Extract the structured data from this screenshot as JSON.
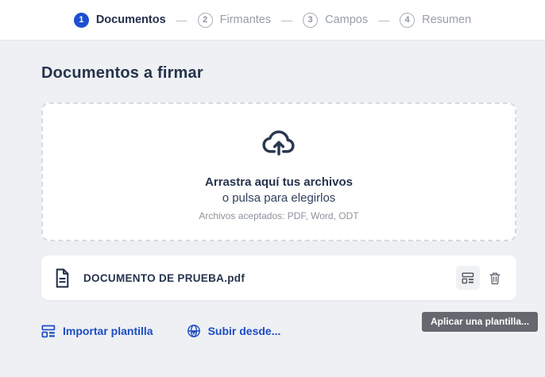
{
  "stepper": {
    "separator": "—",
    "steps": [
      {
        "number": "1",
        "label": "Documentos",
        "state": "active"
      },
      {
        "number": "2",
        "label": "Firmantes",
        "state": "inactive"
      },
      {
        "number": "3",
        "label": "Campos",
        "state": "inactive"
      },
      {
        "number": "4",
        "label": "Resumen",
        "state": "inactive"
      }
    ]
  },
  "page": {
    "title": "Documentos a firmar"
  },
  "dropzone": {
    "icon": "cloud-upload-icon",
    "line1": "Arrastra aquí tus archivos",
    "line2": "o pulsa para elegirlos",
    "line3": "Archivos aceptados: PDF, Word, ODT"
  },
  "file": {
    "icon": "document-icon",
    "name": "DOCUMENTO DE PRUEBA.pdf",
    "actions": [
      "apply-template",
      "delete"
    ]
  },
  "tooltip": {
    "text": "Aplicar una plantilla..."
  },
  "actions": {
    "import_template": "Importar plantilla",
    "upload_from": "Subir desde..."
  },
  "colors": {
    "accent_blue": "#1d4fd1",
    "link_blue": "#1c4cc4",
    "dark_navy": "#26334d",
    "muted_gray": "#8d929c",
    "stepper_inactive": "#989ea7",
    "tooltip_bg": "#65686e",
    "page_bg": "#eef0f3",
    "card_bg": "#ffffff",
    "dashed_border": "#d7dade"
  }
}
